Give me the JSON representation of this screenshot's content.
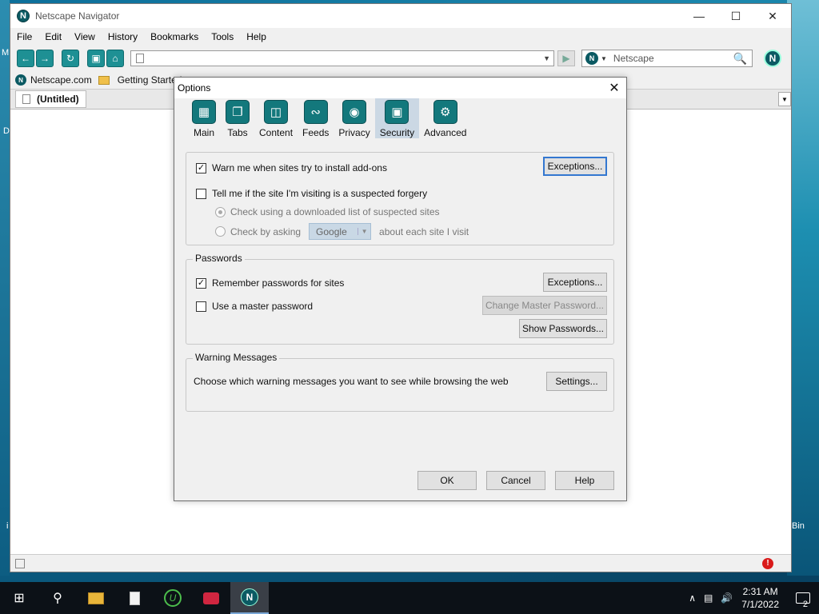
{
  "desktop": {
    "fragments": [
      "M",
      "D",
      "i",
      "Bin"
    ]
  },
  "window": {
    "title": "Netscape Navigator",
    "logo": "N",
    "controls": [
      "minimize-icon",
      "maximize-icon",
      "close-icon"
    ]
  },
  "menu": [
    "File",
    "Edit",
    "View",
    "History",
    "Bookmarks",
    "Tools",
    "Help"
  ],
  "search": {
    "placeholder": "Netscape"
  },
  "bookmarks": [
    {
      "label": "Netscape.com",
      "icon": "netscape-icon"
    },
    {
      "label": "Getting Started",
      "icon": "folder-icon"
    }
  ],
  "tab": {
    "label": "(Untitled)"
  },
  "dialog": {
    "title": "Options",
    "panes": [
      {
        "label": "Main",
        "icon": "main-icon",
        "active": false
      },
      {
        "label": "Tabs",
        "icon": "tabs-icon",
        "active": false
      },
      {
        "label": "Content",
        "icon": "content-icon",
        "active": false
      },
      {
        "label": "Feeds",
        "icon": "feeds-icon",
        "active": false
      },
      {
        "label": "Privacy",
        "icon": "privacy-icon",
        "active": false
      },
      {
        "label": "Security",
        "icon": "lock-icon",
        "active": true
      },
      {
        "label": "Advanced",
        "icon": "gear-icon",
        "active": false
      }
    ],
    "security": {
      "warn_addons": {
        "label": "Warn me when sites try to install add-ons",
        "checked": true
      },
      "exceptions_label": "Exceptions...",
      "forgery": {
        "label": "Tell me if the site I'm visiting is a suspected forgery",
        "checked": false
      },
      "radio_downloaded": "Check using a downloaded list of suspected sites",
      "radio_asking": "Check by asking",
      "provider": "Google",
      "radio_asking_suffix": "about each site I visit"
    },
    "passwords": {
      "legend": "Passwords",
      "remember": {
        "label": "Remember passwords for sites",
        "checked": true
      },
      "exceptions_label": "Exceptions...",
      "master": {
        "label": "Use a master password",
        "checked": false
      },
      "change_master_label": "Change Master Password...",
      "show_label": "Show Passwords..."
    },
    "warnings": {
      "legend": "Warning Messages",
      "text": "Choose which warning messages you want to see while browsing the web",
      "settings_label": "Settings..."
    },
    "buttons": {
      "ok": "OK",
      "cancel": "Cancel",
      "help": "Help"
    }
  },
  "taskbar": {
    "time": "2:31 AM",
    "date": "7/1/2022",
    "notifications": "2"
  }
}
